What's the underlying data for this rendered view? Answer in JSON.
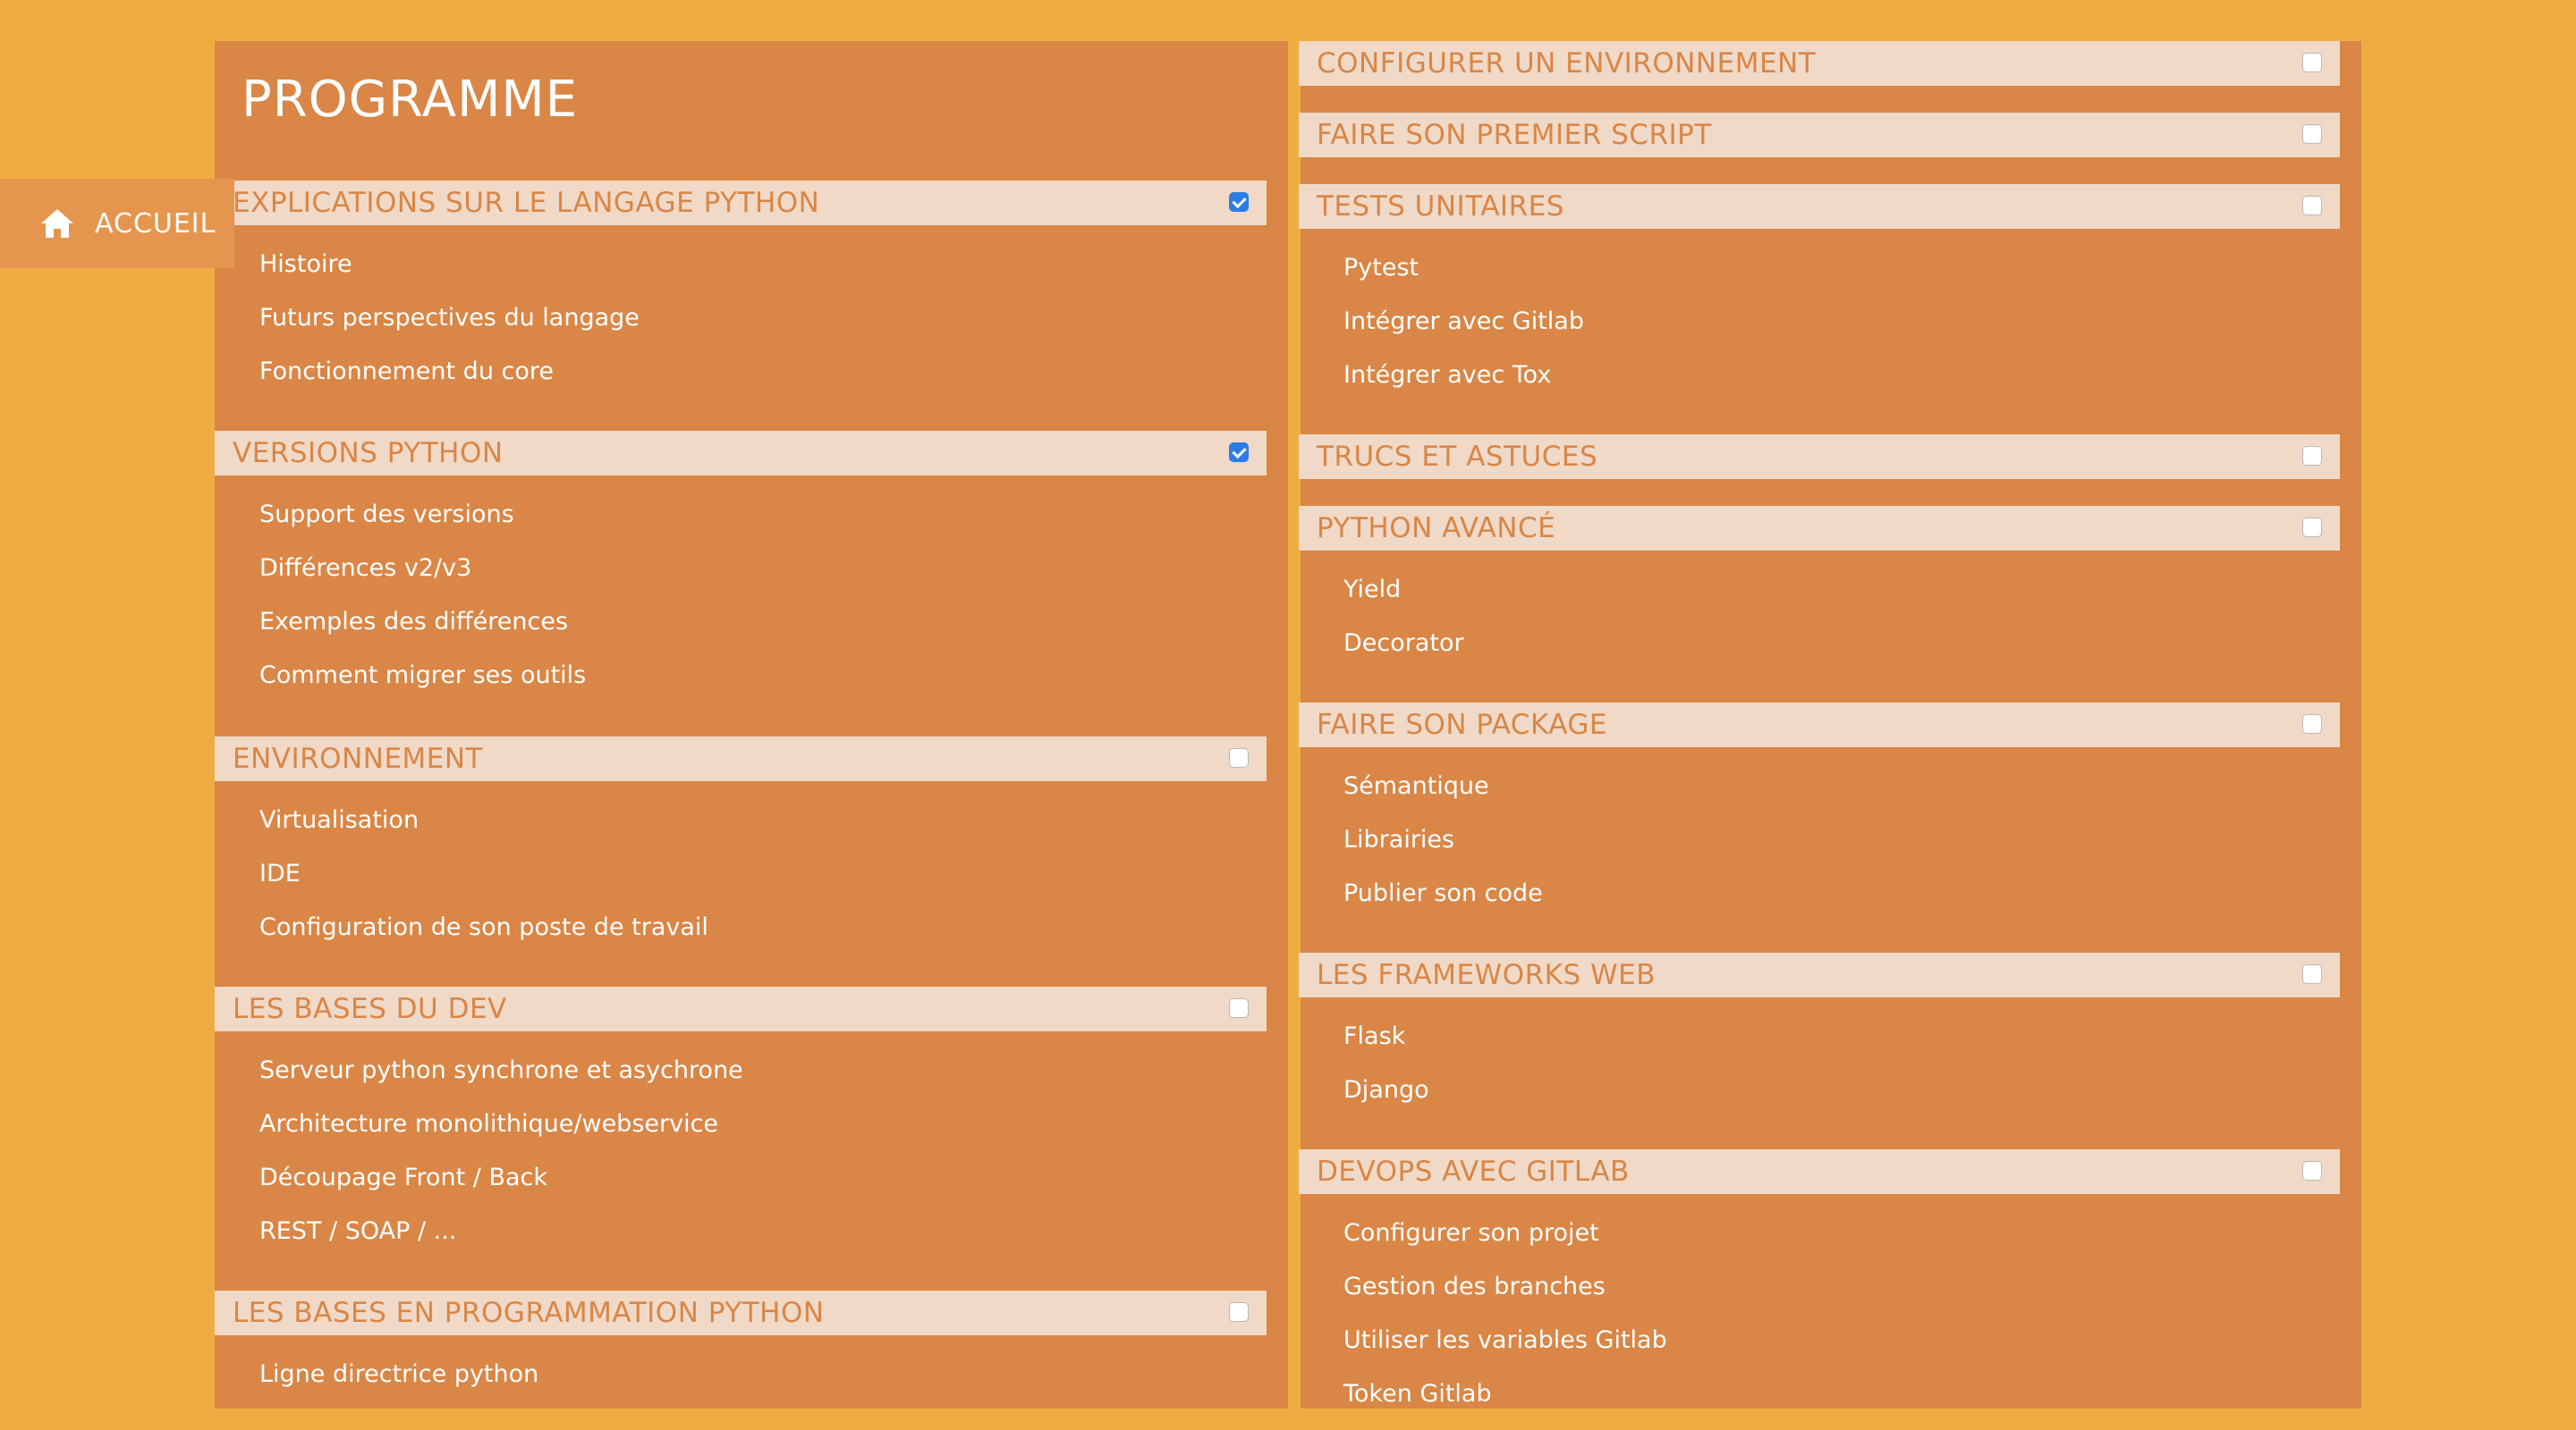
{
  "page": {
    "title": "PROGRAMME"
  },
  "nav": {
    "home_label": "ACCUEIL",
    "home_icon": "home-icon"
  },
  "colors": {
    "background": "#efac43",
    "panel": "#d98646",
    "section_header": "#f0d9c7",
    "checkbox_checked": "#2d7ce6",
    "text": "#ffffff"
  },
  "left_sections": [
    {
      "title": "EXPLICATIONS SUR LE LANGAGE PYTHON",
      "checked": true,
      "items": [
        "Histoire",
        "Futurs perspectives du langage",
        "Fonctionnement du core"
      ]
    },
    {
      "title": "VERSIONS PYTHON",
      "checked": true,
      "items": [
        "Support des versions",
        "Différences v2/v3",
        "Exemples des différences",
        "Comment migrer ses outils"
      ]
    },
    {
      "title": "ENVIRONNEMENT",
      "checked": false,
      "items": [
        "Virtualisation",
        "IDE",
        "Configuration de son poste de travail"
      ]
    },
    {
      "title": "LES BASES DU DEV",
      "checked": false,
      "items": [
        "Serveur python synchrone et asychrone",
        "Architecture monolithique/webservice",
        "Découpage Front / Back",
        "REST / SOAP / ..."
      ]
    },
    {
      "title": "LES BASES EN PROGRAMMATION PYTHON",
      "checked": false,
      "items": [
        "Ligne directrice python"
      ]
    }
  ],
  "right_sections": [
    {
      "title": "CONFIGURER UN ENVIRONNEMENT",
      "checked": false,
      "items": []
    },
    {
      "title": "FAIRE SON PREMIER SCRIPT",
      "checked": false,
      "items": []
    },
    {
      "title": "TESTS UNITAIRES",
      "checked": false,
      "items": [
        "Pytest",
        "Intégrer avec Gitlab",
        "Intégrer avec Tox"
      ]
    },
    {
      "title": "TRUCS ET ASTUCES",
      "checked": false,
      "items": []
    },
    {
      "title": "PYTHON AVANCÉ",
      "checked": false,
      "items": [
        "Yield",
        "Decorator"
      ]
    },
    {
      "title": "FAIRE SON PACKAGE",
      "checked": false,
      "items": [
        "Sémantique",
        "Librairies",
        "Publier son code"
      ]
    },
    {
      "title": "LES FRAMEWORKS WEB",
      "checked": false,
      "items": [
        "Flask",
        "Django"
      ]
    },
    {
      "title": "DEVOPS AVEC GITLAB",
      "checked": false,
      "items": [
        "Configurer son projet",
        "Gestion des branches",
        "Utiliser les variables Gitlab",
        "Token Gitlab"
      ]
    }
  ]
}
